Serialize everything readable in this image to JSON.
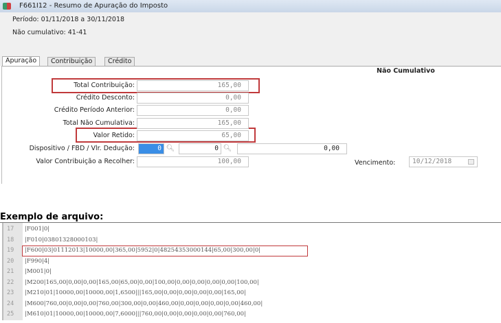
{
  "window": {
    "title": "F661I12 - Resumo de Apuração do Imposto"
  },
  "header": {
    "periodo": "Período: 01/11/2018 a 30/11/2018",
    "nao_cumulativo": "Não cumulativo: 41-41"
  },
  "tabs": [
    {
      "label": "Apuração",
      "active": true
    },
    {
      "label": "Contribuição"
    },
    {
      "label": "Crédito"
    }
  ],
  "section_title": "Não Cumulativo",
  "fields": [
    {
      "label": "Total Contribuição:",
      "value": "165,00"
    },
    {
      "label": "Crédito Desconto:",
      "value": "0,00"
    },
    {
      "label": "Crédito Período Anterior:",
      "value": "0,00"
    },
    {
      "label": "Total Não Cumulativa:",
      "value": "165,00"
    },
    {
      "label": "Valor Retido:",
      "value": "65,00"
    }
  ],
  "dispositivo": {
    "label": "Dispositivo / FBD / Vlr. Dedução:",
    "dispositivo": "0",
    "fbd": "0",
    "deducao": "0,00"
  },
  "recolher": {
    "label": "Valor Contribuição a Recolher:",
    "value": "100,00"
  },
  "vencimento": {
    "label": "Vencimento:",
    "value": "10/12/2018"
  },
  "example": {
    "title": "Exemplo de arquivo:",
    "lines": [
      {
        "n": "17",
        "text": "|F001|0|"
      },
      {
        "n": "18",
        "text": "|F010|03801328000103|"
      },
      {
        "n": "19",
        "text": "|F600|03|01112013|10000,00|365,00|5952|0|48254353000144|65,00|300,00|0|"
      },
      {
        "n": "20",
        "text": "|F990|4|"
      },
      {
        "n": "21",
        "text": "|M001|0|"
      },
      {
        "n": "22",
        "text": "|M200|165,00|0,00|0,00|165,00|65,00|0,00|100,00|0,00|0,00|0,00|0,00|100,00|"
      },
      {
        "n": "23",
        "text": "|M210|01|10000,00|10000,00|1,6500|||165,00|0,00|0,00|0,00|0,00|165,00|"
      },
      {
        "n": "24",
        "text": "|M600|760,00|0,00|0,00|760,00|300,00|0,00|460,00|0,00|0,00|0,00|0,00|460,00|"
      },
      {
        "n": "25",
        "text": "|M610|01|10000,00|10000,00|7,6000|||760,00|0,00|0,00|0,00|0,00|760,00|"
      }
    ]
  },
  "colors": {
    "highlight": "#c0393b",
    "selection": "#3a8ee6"
  }
}
